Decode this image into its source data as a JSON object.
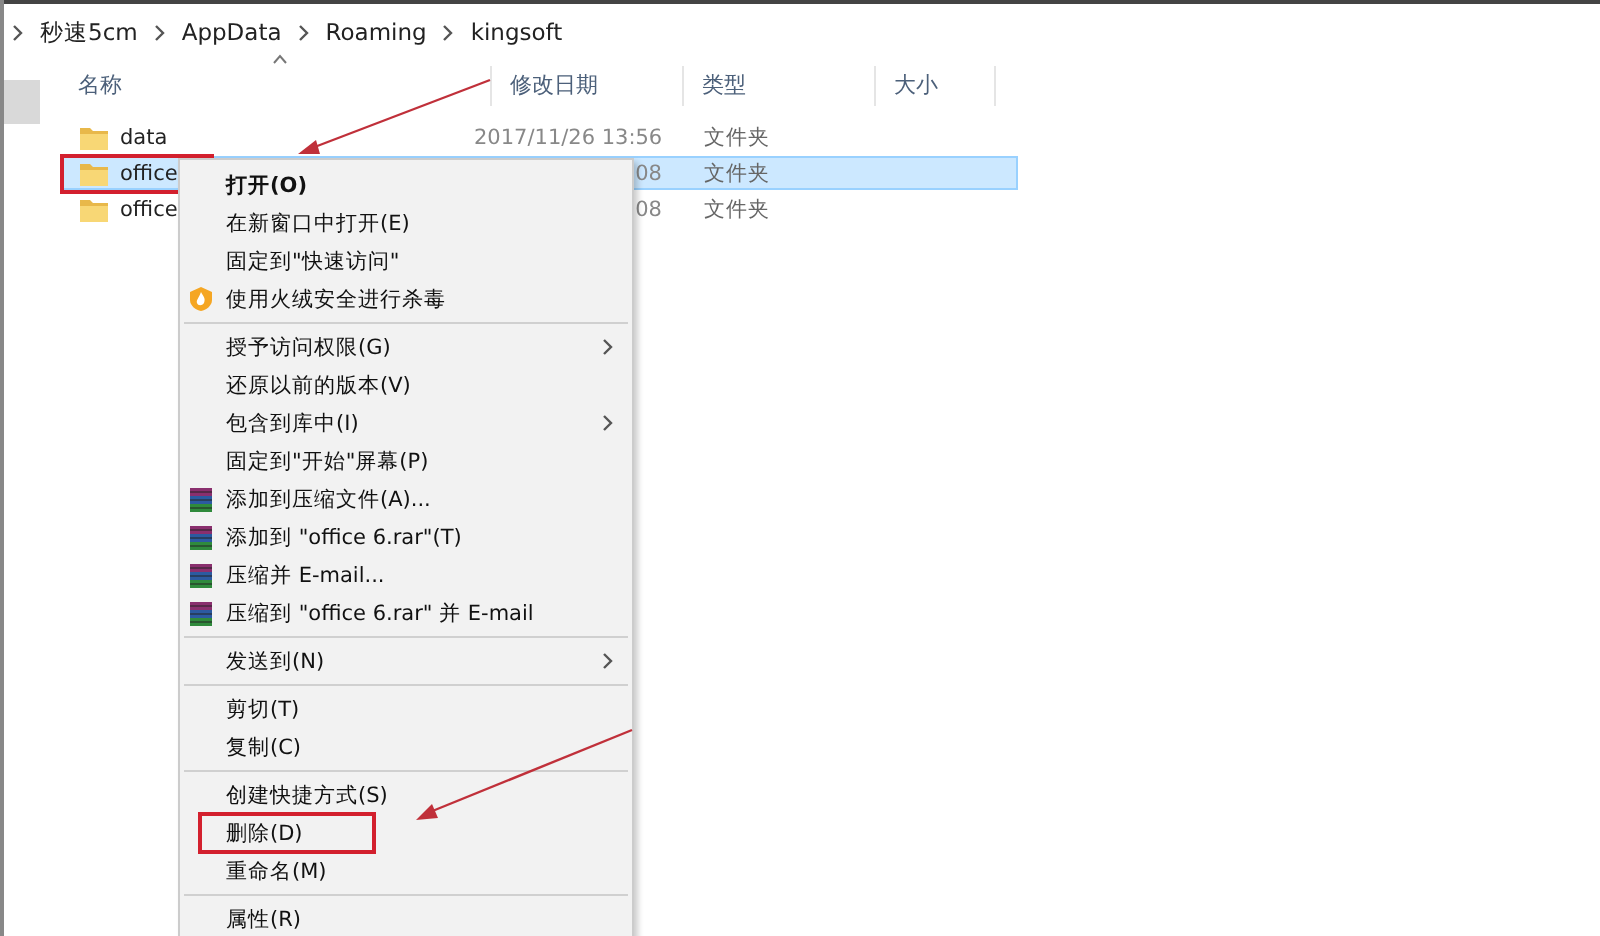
{
  "breadcrumb": [
    "秒速5cm",
    "AppData",
    "Roaming",
    "kingsoft"
  ],
  "columns": [
    "名称",
    "修改日期",
    "类型",
    "大小"
  ],
  "files": [
    {
      "name": "data",
      "modified": "2017/11/26 13:56",
      "type": "文件夹",
      "selected": false,
      "annotated": false
    },
    {
      "name": "office",
      "modified": "08",
      "type": "文件夹",
      "selected": true,
      "annotated": true
    },
    {
      "name": "office",
      "modified": "08",
      "type": "文件夹",
      "selected": false,
      "annotated": false
    }
  ],
  "context_menu": {
    "groups": [
      [
        {
          "label": "打开(O)",
          "bold": true,
          "kind": "plain",
          "submenu": false,
          "annotated": false
        },
        {
          "label": "在新窗口中打开(E)",
          "bold": false,
          "kind": "plain",
          "submenu": false,
          "annotated": false
        },
        {
          "label": "固定到\"快速访问\"",
          "bold": false,
          "kind": "plain",
          "submenu": false,
          "annotated": false
        },
        {
          "label": "使用火绒安全进行杀毒",
          "bold": false,
          "kind": "antivirus",
          "submenu": false,
          "annotated": false
        }
      ],
      [
        {
          "label": "授予访问权限(G)",
          "bold": false,
          "kind": "plain",
          "submenu": true,
          "annotated": false
        },
        {
          "label": "还原以前的版本(V)",
          "bold": false,
          "kind": "plain",
          "submenu": false,
          "annotated": false
        },
        {
          "label": "包含到库中(I)",
          "bold": false,
          "kind": "plain",
          "submenu": true,
          "annotated": false
        },
        {
          "label": "固定到\"开始\"屏幕(P)",
          "bold": false,
          "kind": "plain",
          "submenu": false,
          "annotated": false
        },
        {
          "label": "添加到压缩文件(A)...",
          "bold": false,
          "kind": "archive",
          "submenu": false,
          "annotated": false
        },
        {
          "label": "添加到 \"office 6.rar\"(T)",
          "bold": false,
          "kind": "archive",
          "submenu": false,
          "annotated": false
        },
        {
          "label": "压缩并 E-mail...",
          "bold": false,
          "kind": "archive",
          "submenu": false,
          "annotated": false
        },
        {
          "label": "压缩到 \"office 6.rar\" 并 E-mail",
          "bold": false,
          "kind": "archive",
          "submenu": false,
          "annotated": false
        }
      ],
      [
        {
          "label": "发送到(N)",
          "bold": false,
          "kind": "plain",
          "submenu": true,
          "annotated": false
        }
      ],
      [
        {
          "label": "剪切(T)",
          "bold": false,
          "kind": "plain",
          "submenu": false,
          "annotated": false
        },
        {
          "label": "复制(C)",
          "bold": false,
          "kind": "plain",
          "submenu": false,
          "annotated": false
        }
      ],
      [
        {
          "label": "创建快捷方式(S)",
          "bold": false,
          "kind": "plain",
          "submenu": false,
          "annotated": false
        },
        {
          "label": "删除(D)",
          "bold": false,
          "kind": "plain",
          "submenu": false,
          "annotated": true
        },
        {
          "label": "重命名(M)",
          "bold": false,
          "kind": "plain",
          "submenu": false,
          "annotated": false
        }
      ],
      [
        {
          "label": "属性(R)",
          "bold": false,
          "kind": "plain",
          "submenu": false,
          "annotated": false
        }
      ]
    ]
  }
}
